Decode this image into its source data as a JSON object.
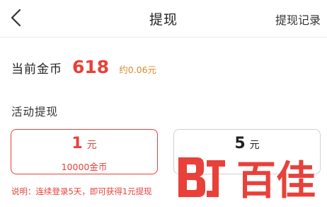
{
  "header": {
    "title": "提现",
    "record_label": "提现记录"
  },
  "balance": {
    "label": "当前金币",
    "value": "618",
    "approx": "约0.06元"
  },
  "section": {
    "title": "活动提现"
  },
  "options": [
    {
      "amount": "1",
      "unit": "元",
      "coins": "10000金币",
      "selected": true
    },
    {
      "amount": "5",
      "unit": "元",
      "selected": false
    }
  ],
  "note": "说明：连续登录5天，即可获得1元提现",
  "watermark": {
    "text": "百佳"
  },
  "colors": {
    "accent": "#e8413a",
    "approx": "#d98a2a",
    "border": "#cfcfcf"
  },
  "icons": {
    "back": "chevron-left-icon"
  }
}
